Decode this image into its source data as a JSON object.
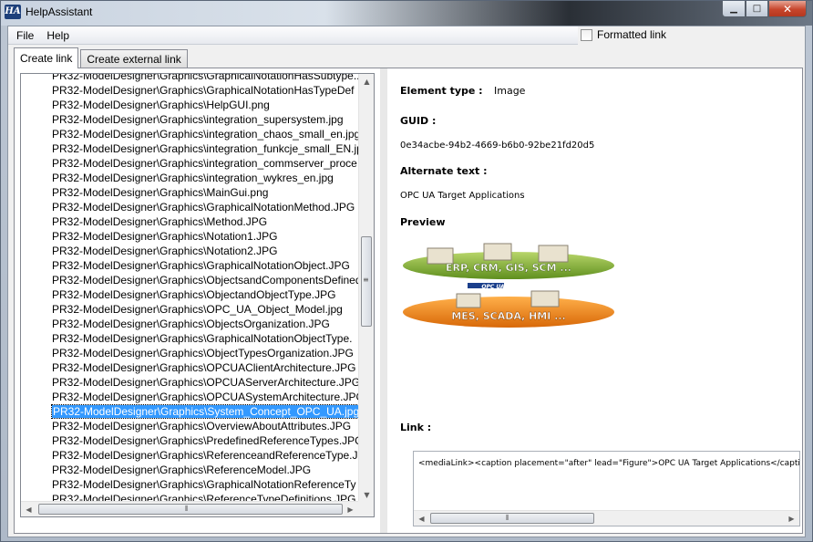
{
  "window": {
    "title": "HelpAssistant",
    "icon_text": "HA",
    "buttons": {
      "minimize": "minimize-icon",
      "maximize": "maximize-icon",
      "close": "close-icon"
    }
  },
  "menu": {
    "file": "File",
    "help": "Help"
  },
  "formatted_link": {
    "label": "Formatted link",
    "checked": false
  },
  "tabs": [
    {
      "label": "Create link",
      "active": true
    },
    {
      "label": "Create external link",
      "active": false
    }
  ],
  "resource_list": {
    "items": [
      "PR32-ModelDesigner\\Graphics\\GraphicalNotationHasSubtype...",
      "PR32-ModelDesigner\\Graphics\\GraphicalNotationHasTypeDef",
      "PR32-ModelDesigner\\Graphics\\HelpGUI.png",
      "PR32-ModelDesigner\\Graphics\\integration_supersystem.jpg",
      "PR32-ModelDesigner\\Graphics\\integration_chaos_small_en.jpg",
      "PR32-ModelDesigner\\Graphics\\integration_funkcje_small_EN.jp",
      "PR32-ModelDesigner\\Graphics\\integration_commserver_proce",
      "PR32-ModelDesigner\\Graphics\\integration_wykres_en.jpg",
      "PR32-ModelDesigner\\Graphics\\MainGui.png",
      "PR32-ModelDesigner\\Graphics\\GraphicalNotationMethod.JPG",
      "PR32-ModelDesigner\\Graphics\\Method.JPG",
      "PR32-ModelDesigner\\Graphics\\Notation1.JPG",
      "PR32-ModelDesigner\\Graphics\\Notation2.JPG",
      "PR32-ModelDesigner\\Graphics\\GraphicalNotationObject.JPG",
      "PR32-ModelDesigner\\Graphics\\ObjectsandComponentsDefined",
      "PR32-ModelDesigner\\Graphics\\ObjectandObjectType.JPG",
      "PR32-ModelDesigner\\Graphics\\OPC_UA_Object_Model.jpg",
      "PR32-ModelDesigner\\Graphics\\ObjectsOrganization.JPG",
      "PR32-ModelDesigner\\Graphics\\GraphicalNotationObjectType.",
      "PR32-ModelDesigner\\Graphics\\ObjectTypesOrganization.JPG",
      "PR32-ModelDesigner\\Graphics\\OPCUAClientArchitecture.JPG",
      "PR32-ModelDesigner\\Graphics\\OPCUAServerArchitecture.JPG",
      "PR32-ModelDesigner\\Graphics\\OPCUASystemArchitecture.JPG",
      "PR32-ModelDesigner\\Graphics\\System_Concept_OPC_UA.jpg",
      "PR32-ModelDesigner\\Graphics\\OverviewAboutAttributes.JPG",
      "PR32-ModelDesigner\\Graphics\\PredefinedReferenceTypes.JPG",
      "PR32-ModelDesigner\\Graphics\\ReferenceandReferenceType.JP",
      "PR32-ModelDesigner\\Graphics\\ReferenceModel.JPG",
      "PR32-ModelDesigner\\Graphics\\GraphicalNotationReferenceTy",
      "PR32-ModelDesigner\\Graphics\\ReferenceTypeDefinitions.JPG"
    ],
    "selected_index": 23
  },
  "details": {
    "element_type_label": "Element type :",
    "element_type_value": "Image",
    "guid_label": "GUID :",
    "guid_value": "0e34acbe-94b2-4669-b6b0-92be21fd20d5",
    "alternate_text_label": "Alternate text :",
    "alternate_text_value": "OPC UA Target Applications",
    "preview_label": "Preview",
    "preview_image": {
      "top_layer_text": "ERP, CRM, GIS, SCM ...",
      "bottom_layer_text": "MES, SCADA, HMI ...",
      "logo_text": "OPC UA"
    },
    "link_label": "Link :",
    "link_value": "<mediaLink><caption placement=\"after\" lead=\"Figure\">OPC UA Target Applications</caption"
  },
  "colors": {
    "selection": "#3399ff",
    "close_button": "#c7452c"
  }
}
